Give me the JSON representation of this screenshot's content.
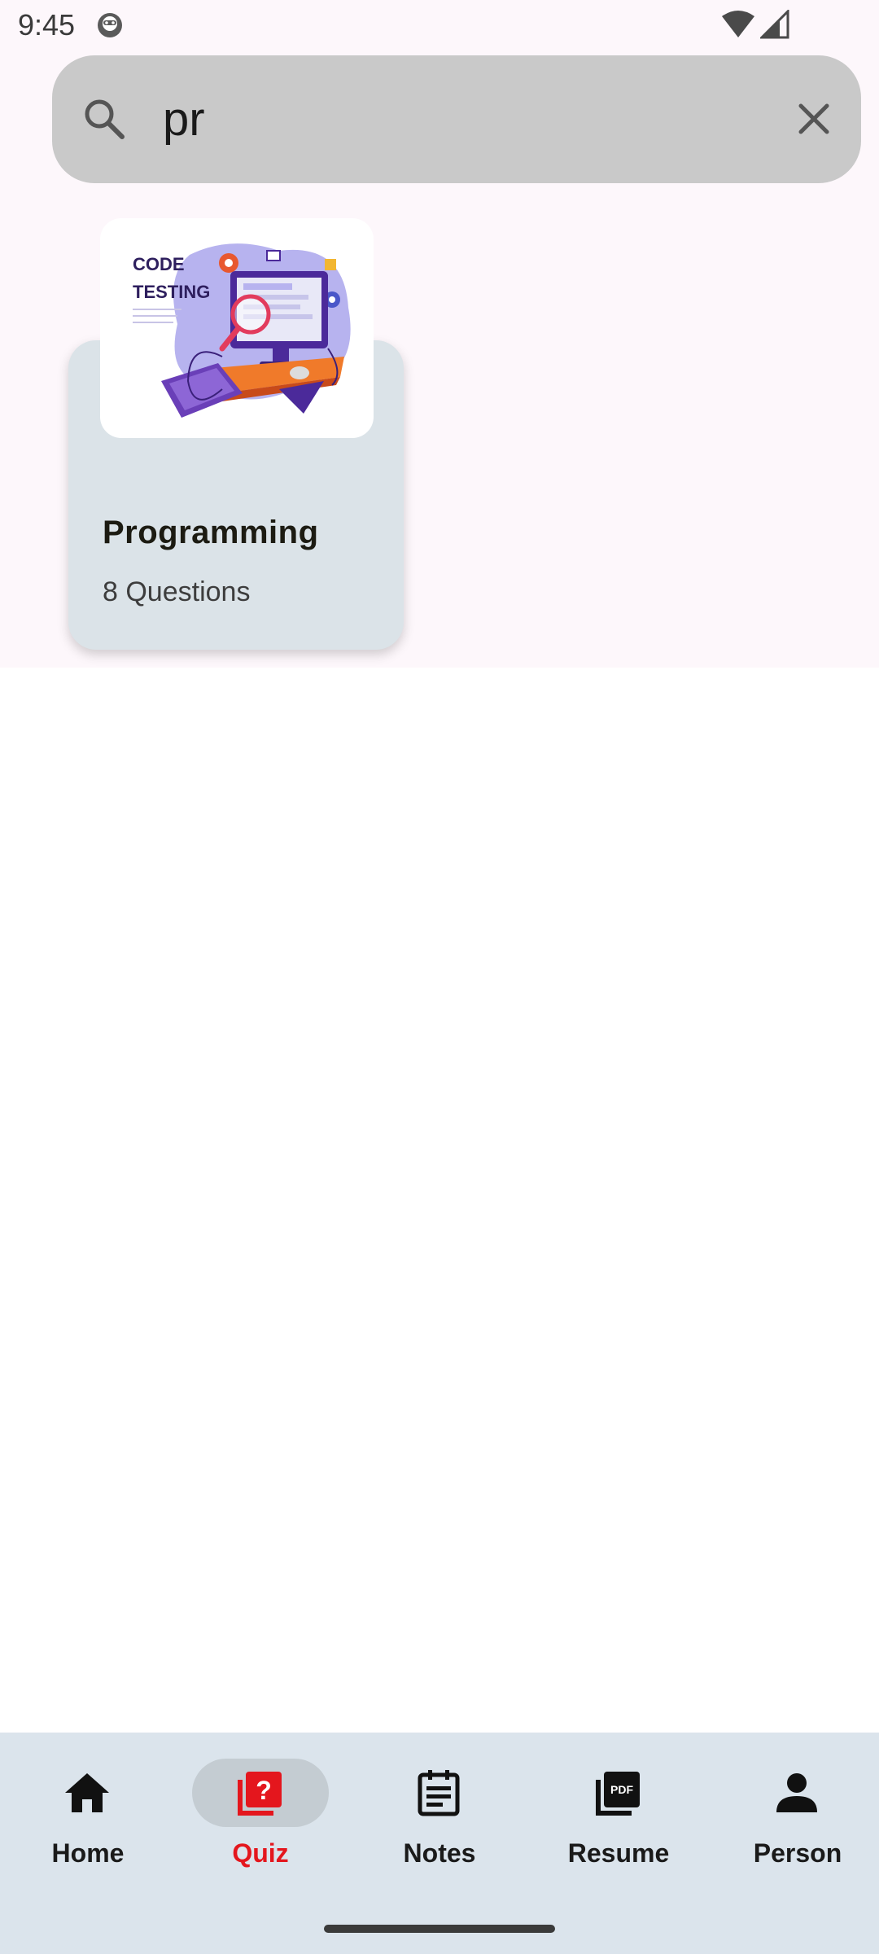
{
  "status_bar": {
    "time": "9:45"
  },
  "search": {
    "query": "pr",
    "placeholder": ""
  },
  "quiz_card": {
    "title": "Programming",
    "question_count": "8 Questions",
    "image_text_line1": "CODE",
    "image_text_line2": "TESTING"
  },
  "bottom_nav": {
    "items": [
      {
        "label": "Home",
        "icon": "home-icon"
      },
      {
        "label": "Quiz",
        "icon": "quiz-icon",
        "active": true
      },
      {
        "label": "Notes",
        "icon": "notes-icon"
      },
      {
        "label": "Resume",
        "icon": "pdf-icon"
      },
      {
        "label": "Person",
        "icon": "person-icon"
      }
    ]
  },
  "colors": {
    "accent": "#e4161d",
    "nav_background": "#dbe4ec",
    "card_background": "#dbe3e8",
    "search_background": "#c9c9c9"
  }
}
